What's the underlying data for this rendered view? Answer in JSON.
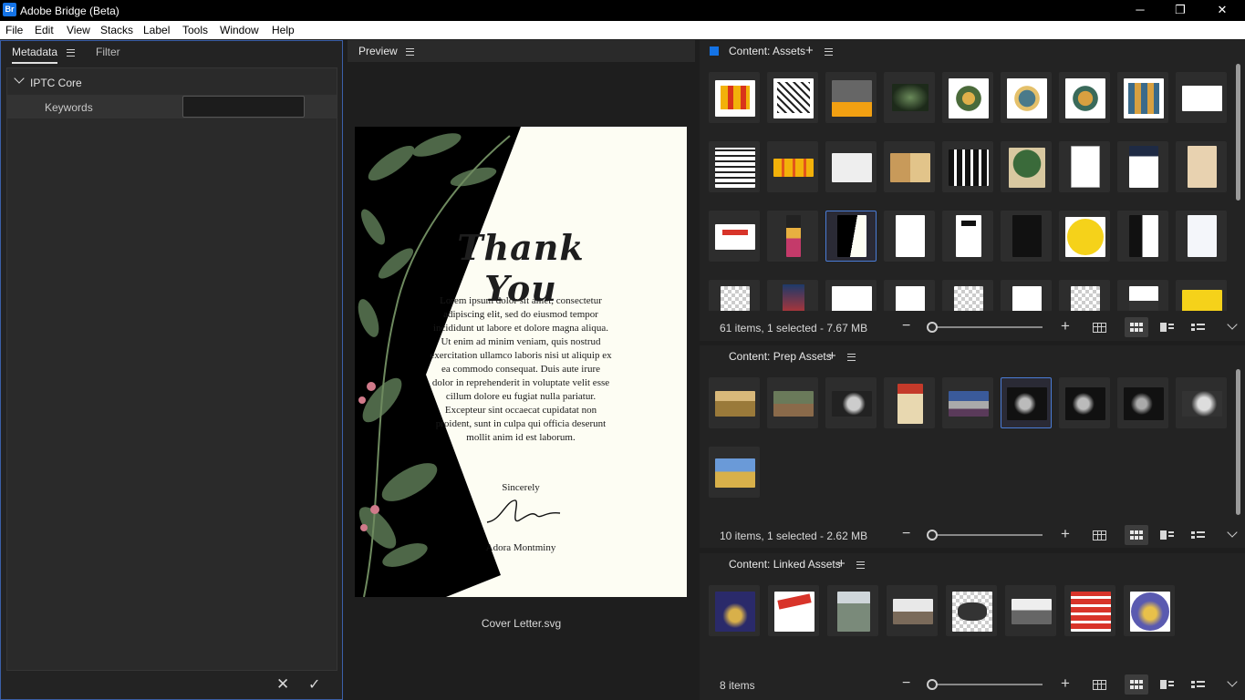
{
  "window": {
    "title": "Adobe Bridge (Beta)",
    "icon_text": "Br",
    "minimize": "─",
    "restore": "❐",
    "close": "✕"
  },
  "menu": [
    "File",
    "Edit",
    "View",
    "Stacks",
    "Label",
    "Tools",
    "Window",
    "Help"
  ],
  "metadata_panel": {
    "tabs": [
      "Metadata",
      "Filter"
    ],
    "section": "IPTC Core",
    "keywords_label": "Keywords",
    "keywords_value": "",
    "cancel_glyph": "✕",
    "apply_glyph": "✓"
  },
  "preview_panel": {
    "tab": "Preview",
    "filename": "Cover Letter.svg",
    "letter": {
      "heading": "Thank You",
      "body": "Lorem ipsum dolor sit amet, consectetur adipiscing elit, sed do eiusmod tempor incididunt ut labore et dolore magna aliqua. Ut enim ad minim veniam, quis nostrud exercitation ullamco laboris nisi ut aliquip ex ea commodo consequat. Duis aute irure dolor in reprehenderit in voluptate velit esse cillum dolore eu fugiat nulla pariatur. Excepteur sint occaecat cupidatat non proident, sunt in culpa qui officia deserunt mollit anim id est laborum.",
      "closing": "Sincerely",
      "name": "Adora Montminy"
    }
  },
  "content_panels": [
    {
      "tab": "Content: Assets",
      "status": "61 items, 1 selected - 7.67 MB"
    },
    {
      "tab": "Content: Prep Assets",
      "status": "10 items, 1 selected - 2.62 MB"
    },
    {
      "tab": "Content: Linked Assets",
      "status": "8 items"
    }
  ],
  "colors": {
    "accent": "#1473e6",
    "selection": "#4a7cd6",
    "panel": "#252525",
    "bg": "#1e1e1e"
  }
}
